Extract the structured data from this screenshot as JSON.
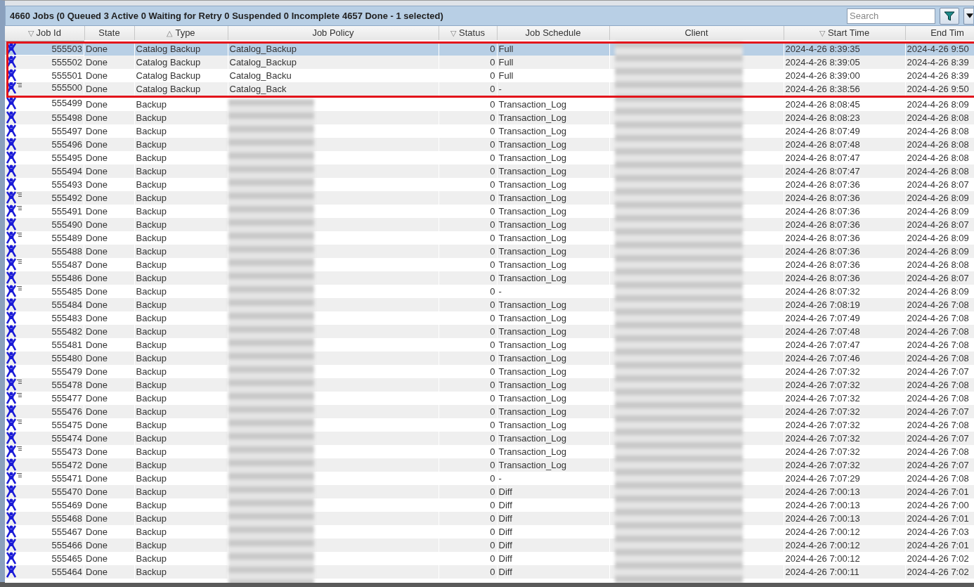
{
  "panel": {
    "summary": "4660 Jobs (0 Queued 3 Active 0 Waiting for Retry 0 Suspended 0 Incomplete 4657 Done - 1 selected)",
    "search": {
      "placeholder": "Search"
    },
    "buttons": [
      {
        "kind": "filter"
      },
      {
        "kind": "dropdown"
      }
    ]
  },
  "table": {
    "columns": [
      {
        "label": "Job Id",
        "sort_mark": "▽"
      },
      {
        "label": "State"
      },
      {
        "label": "Type",
        "sort_mark": "△"
      },
      {
        "label": "Job Policy"
      },
      {
        "label": "Status",
        "sort_mark": "▽"
      },
      {
        "label": "Job Schedule"
      },
      {
        "label": "Client"
      },
      {
        "label": "Start Time",
        "sort_mark": "▽"
      },
      {
        "label": "End Tim"
      }
    ],
    "rows": [
      {
        "job_id": "555503",
        "state": "Done",
        "type": "Catalog Backup",
        "job_policy": "Catalog_Backup",
        "status": "0",
        "job_schedule": "Full",
        "start_time": "2024-4-26 8:39:35",
        "end_time": "2024-4-26 9:50",
        "has_subjobs": false,
        "selected": true
      },
      {
        "job_id": "555502",
        "state": "Done",
        "type": "Catalog Backup",
        "job_policy": "Catalog_Backup",
        "status": "0",
        "job_schedule": "Full",
        "start_time": "2024-4-26 8:39:05",
        "end_time": "2024-4-26 8:39",
        "has_subjobs": false,
        "selected": false
      },
      {
        "job_id": "555501",
        "state": "Done",
        "type": "Catalog Backup",
        "job_policy": "Catalog_Backu",
        "status": "0",
        "job_schedule": "Full",
        "start_time": "2024-4-26 8:39:00",
        "end_time": "2024-4-26 8:39",
        "has_subjobs": false,
        "selected": false
      },
      {
        "job_id": "555500",
        "state": "Done",
        "type": "Catalog Backup",
        "job_policy": "Catalog_Back",
        "status": "0",
        "job_schedule": "-",
        "start_time": "2024-4-26 8:38:56",
        "end_time": "2024-4-26 9:50",
        "has_subjobs": true,
        "selected": false
      },
      {
        "job_id": "555499",
        "state": "Done",
        "type": "Backup",
        "status": "0",
        "job_schedule": "Transaction_Log",
        "start_time": "2024-4-26 8:08:45",
        "end_time": "2024-4-26 8:09",
        "has_subjobs": false,
        "selected": false
      },
      {
        "job_id": "555498",
        "state": "Done",
        "type": "Backup",
        "status": "0",
        "job_schedule": "Transaction_Log",
        "start_time": "2024-4-26 8:08:23",
        "end_time": "2024-4-26 8:08",
        "has_subjobs": false,
        "selected": false
      },
      {
        "job_id": "555497",
        "state": "Done",
        "type": "Backup",
        "status": "0",
        "job_schedule": "Transaction_Log",
        "start_time": "2024-4-26 8:07:49",
        "end_time": "2024-4-26 8:08",
        "has_subjobs": false,
        "selected": false
      },
      {
        "job_id": "555496",
        "state": "Done",
        "type": "Backup",
        "status": "0",
        "job_schedule": "Transaction_Log",
        "start_time": "2024-4-26 8:07:48",
        "end_time": "2024-4-26 8:08",
        "has_subjobs": false,
        "selected": false
      },
      {
        "job_id": "555495",
        "state": "Done",
        "type": "Backup",
        "status": "0",
        "job_schedule": "Transaction_Log",
        "start_time": "2024-4-26 8:07:47",
        "end_time": "2024-4-26 8:08",
        "has_subjobs": false,
        "selected": false
      },
      {
        "job_id": "555494",
        "state": "Done",
        "type": "Backup",
        "status": "0",
        "job_schedule": "Transaction_Log",
        "start_time": "2024-4-26 8:07:47",
        "end_time": "2024-4-26 8:08",
        "has_subjobs": false,
        "selected": false
      },
      {
        "job_id": "555493",
        "state": "Done",
        "type": "Backup",
        "status": "0",
        "job_schedule": "Transaction_Log",
        "start_time": "2024-4-26 8:07:36",
        "end_time": "2024-4-26 8:07",
        "has_subjobs": false,
        "selected": false
      },
      {
        "job_id": "555492",
        "state": "Done",
        "type": "Backup",
        "status": "0",
        "job_schedule": "Transaction_Log",
        "start_time": "2024-4-26 8:07:36",
        "end_time": "2024-4-26 8:09",
        "has_subjobs": true,
        "selected": false
      },
      {
        "job_id": "555491",
        "state": "Done",
        "type": "Backup",
        "status": "0",
        "job_schedule": "Transaction_Log",
        "start_time": "2024-4-26 8:07:36",
        "end_time": "2024-4-26 8:09",
        "has_subjobs": true,
        "selected": false
      },
      {
        "job_id": "555490",
        "state": "Done",
        "type": "Backup",
        "status": "0",
        "job_schedule": "Transaction_Log",
        "start_time": "2024-4-26 8:07:36",
        "end_time": "2024-4-26 8:07",
        "has_subjobs": false,
        "selected": false
      },
      {
        "job_id": "555489",
        "state": "Done",
        "type": "Backup",
        "status": "0",
        "job_schedule": "Transaction_Log",
        "start_time": "2024-4-26 8:07:36",
        "end_time": "2024-4-26 8:09",
        "has_subjobs": true,
        "selected": false
      },
      {
        "job_id": "555488",
        "state": "Done",
        "type": "Backup",
        "status": "0",
        "job_schedule": "Transaction_Log",
        "start_time": "2024-4-26 8:07:36",
        "end_time": "2024-4-26 8:09",
        "has_subjobs": false,
        "selected": false
      },
      {
        "job_id": "555487",
        "state": "Done",
        "type": "Backup",
        "status": "0",
        "job_schedule": "Transaction_Log",
        "start_time": "2024-4-26 8:07:36",
        "end_time": "2024-4-26 8:08",
        "has_subjobs": true,
        "selected": false
      },
      {
        "job_id": "555486",
        "state": "Done",
        "type": "Backup",
        "status": "0",
        "job_schedule": "Transaction_Log",
        "start_time": "2024-4-26 8:07:36",
        "end_time": "2024-4-26 8:07",
        "has_subjobs": false,
        "selected": false
      },
      {
        "job_id": "555485",
        "state": "Done",
        "type": "Backup",
        "status": "0",
        "job_schedule": "-",
        "start_time": "2024-4-26 8:07:32",
        "end_time": "2024-4-26 8:09",
        "has_subjobs": true,
        "selected": false
      },
      {
        "job_id": "555484",
        "state": "Done",
        "type": "Backup",
        "status": "0",
        "job_schedule": "Transaction_Log",
        "start_time": "2024-4-26 7:08:19",
        "end_time": "2024-4-26 7:08",
        "has_subjobs": false,
        "selected": false
      },
      {
        "job_id": "555483",
        "state": "Done",
        "type": "Backup",
        "status": "0",
        "job_schedule": "Transaction_Log",
        "start_time": "2024-4-26 7:07:49",
        "end_time": "2024-4-26 7:08",
        "has_subjobs": false,
        "selected": false
      },
      {
        "job_id": "555482",
        "state": "Done",
        "type": "Backup",
        "status": "0",
        "job_schedule": "Transaction_Log",
        "start_time": "2024-4-26 7:07:48",
        "end_time": "2024-4-26 7:08",
        "has_subjobs": false,
        "selected": false
      },
      {
        "job_id": "555481",
        "state": "Done",
        "type": "Backup",
        "status": "0",
        "job_schedule": "Transaction_Log",
        "start_time": "2024-4-26 7:07:47",
        "end_time": "2024-4-26 7:08",
        "has_subjobs": false,
        "selected": false
      },
      {
        "job_id": "555480",
        "state": "Done",
        "type": "Backup",
        "status": "0",
        "job_schedule": "Transaction_Log",
        "start_time": "2024-4-26 7:07:46",
        "end_time": "2024-4-26 7:08",
        "has_subjobs": false,
        "selected": false
      },
      {
        "job_id": "555479",
        "state": "Done",
        "type": "Backup",
        "status": "0",
        "job_schedule": "Transaction_Log",
        "start_time": "2024-4-26 7:07:32",
        "end_time": "2024-4-26 7:07",
        "has_subjobs": false,
        "selected": false
      },
      {
        "job_id": "555478",
        "state": "Done",
        "type": "Backup",
        "status": "0",
        "job_schedule": "Transaction_Log",
        "start_time": "2024-4-26 7:07:32",
        "end_time": "2024-4-26 7:08",
        "has_subjobs": true,
        "selected": false
      },
      {
        "job_id": "555477",
        "state": "Done",
        "type": "Backup",
        "status": "0",
        "job_schedule": "Transaction_Log",
        "start_time": "2024-4-26 7:07:32",
        "end_time": "2024-4-26 7:08",
        "has_subjobs": true,
        "selected": false
      },
      {
        "job_id": "555476",
        "state": "Done",
        "type": "Backup",
        "status": "0",
        "job_schedule": "Transaction_Log",
        "start_time": "2024-4-26 7:07:32",
        "end_time": "2024-4-26 7:07",
        "has_subjobs": false,
        "selected": false
      },
      {
        "job_id": "555475",
        "state": "Done",
        "type": "Backup",
        "status": "0",
        "job_schedule": "Transaction_Log",
        "start_time": "2024-4-26 7:07:32",
        "end_time": "2024-4-26 7:08",
        "has_subjobs": true,
        "selected": false
      },
      {
        "job_id": "555474",
        "state": "Done",
        "type": "Backup",
        "status": "0",
        "job_schedule": "Transaction_Log",
        "start_time": "2024-4-26 7:07:32",
        "end_time": "2024-4-26 7:07",
        "has_subjobs": false,
        "selected": false
      },
      {
        "job_id": "555473",
        "state": "Done",
        "type": "Backup",
        "status": "0",
        "job_schedule": "Transaction_Log",
        "start_time": "2024-4-26 7:07:32",
        "end_time": "2024-4-26 7:08",
        "has_subjobs": true,
        "selected": false
      },
      {
        "job_id": "555472",
        "state": "Done",
        "type": "Backup",
        "status": "0",
        "job_schedule": "Transaction_Log",
        "start_time": "2024-4-26 7:07:32",
        "end_time": "2024-4-26 7:07",
        "has_subjobs": false,
        "selected": false
      },
      {
        "job_id": "555471",
        "state": "Done",
        "type": "Backup",
        "status": "0",
        "job_schedule": "-",
        "start_time": "2024-4-26 7:07:29",
        "end_time": "2024-4-26 7:08",
        "has_subjobs": true,
        "selected": false
      },
      {
        "job_id": "555470",
        "state": "Done",
        "type": "Backup",
        "status": "0",
        "job_schedule": "Diff",
        "start_time": "2024-4-26 7:00:13",
        "end_time": "2024-4-26 7:01",
        "has_subjobs": false,
        "selected": false
      },
      {
        "job_id": "555469",
        "state": "Done",
        "type": "Backup",
        "status": "0",
        "job_schedule": "Diff",
        "start_time": "2024-4-26 7:00:13",
        "end_time": "2024-4-26 7:00",
        "has_subjobs": false,
        "selected": false
      },
      {
        "job_id": "555468",
        "state": "Done",
        "type": "Backup",
        "status": "0",
        "job_schedule": "Diff",
        "start_time": "2024-4-26 7:00:13",
        "end_time": "2024-4-26 7:01",
        "has_subjobs": false,
        "selected": false
      },
      {
        "job_id": "555467",
        "state": "Done",
        "type": "Backup",
        "status": "0",
        "job_schedule": "Diff",
        "start_time": "2024-4-26 7:00:12",
        "end_time": "2024-4-26 7:03",
        "has_subjobs": false,
        "selected": false
      },
      {
        "job_id": "555466",
        "state": "Done",
        "type": "Backup",
        "status": "0",
        "job_schedule": "Diff",
        "start_time": "2024-4-26 7:00:12",
        "end_time": "2024-4-26 7:01",
        "has_subjobs": false,
        "selected": false
      },
      {
        "job_id": "555465",
        "state": "Done",
        "type": "Backup",
        "status": "0",
        "job_schedule": "Diff",
        "start_time": "2024-4-26 7:00:12",
        "end_time": "2024-4-26 7:02",
        "has_subjobs": false,
        "selected": false
      },
      {
        "job_id": "555464",
        "state": "Done",
        "type": "Backup",
        "status": "0",
        "job_schedule": "Diff",
        "start_time": "2024-4-26 7:00:11",
        "end_time": "2024-4-26 7:02",
        "has_subjobs": false,
        "selected": false
      }
    ]
  }
}
